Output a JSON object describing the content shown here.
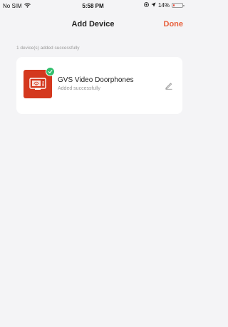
{
  "status_bar": {
    "carrier": "No SIM",
    "wifi_icon": "wifi-icon",
    "time": "5:58 PM",
    "battery_percent": "14%",
    "battery_level": 0.14
  },
  "nav": {
    "title": "Add Device",
    "done_label": "Done"
  },
  "summary": "1 device(s) added successfully",
  "devices": [
    {
      "name": "GVS Video Doorphones",
      "status": "Added successfully",
      "icon": "video-doorphone-icon",
      "badge_icon": "check-icon",
      "edit_icon": "pencil-icon"
    }
  ],
  "colors": {
    "accent": "#e8603c",
    "device_icon_bg": "#d4381e",
    "success": "#33c06f",
    "background": "#f4f4f6"
  }
}
